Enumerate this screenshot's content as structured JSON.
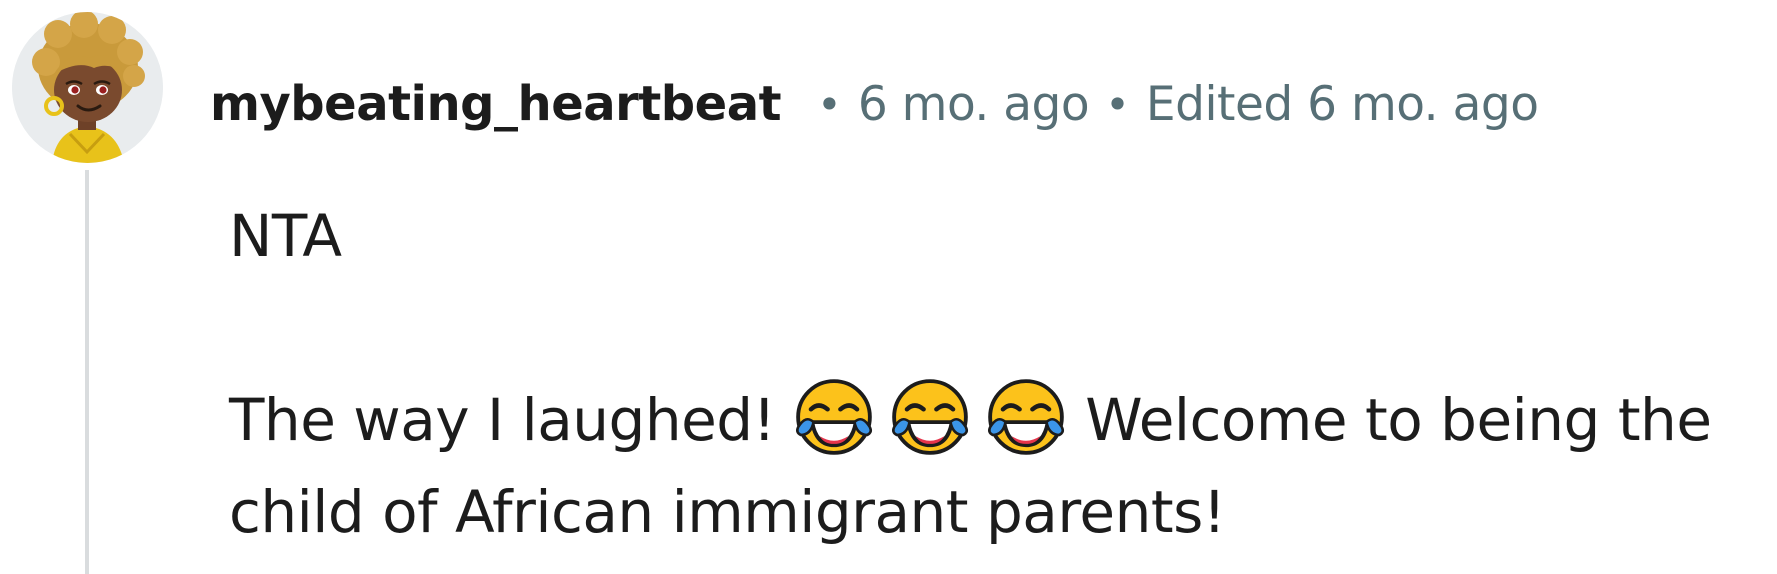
{
  "comment": {
    "author": "mybeating_heartbeat",
    "separator": "•",
    "timestamp": "6 mo. ago",
    "edited": "Edited 6 mo. ago",
    "paragraphs": {
      "p1": "NTA",
      "p2_before": "The way I laughed!",
      "p2_emojis": [
        "face-with-tears-of-joy-icon",
        "face-with-tears-of-joy-icon",
        "face-with-tears-of-joy-icon"
      ],
      "p2_after": "Welcome to being the child of African immigrant parents!"
    }
  },
  "avatar": {
    "icon": "avatar-icon",
    "hair_color": "#c99a3b",
    "skin_color": "#7a4a2e",
    "outfit_color": "#e8c21a",
    "background_color": "#e9ecee"
  },
  "colors": {
    "text": "#1c1c1c",
    "meta": "#576f76",
    "thread_line": "#d9dcde"
  }
}
